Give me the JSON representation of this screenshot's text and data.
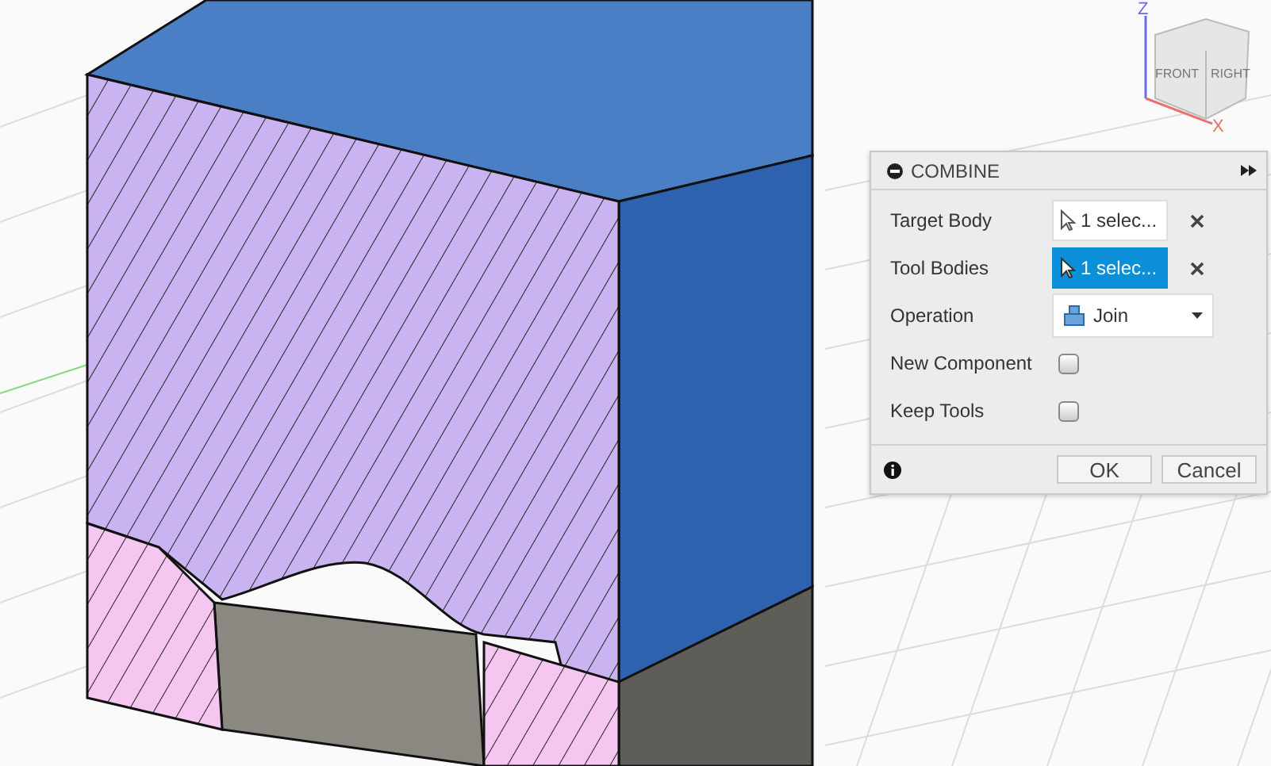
{
  "viewcube": {
    "faces": [
      "FRONT",
      "RIGHT"
    ],
    "axes": [
      "Z",
      "X"
    ]
  },
  "dialog": {
    "title": "COMBINE",
    "rows": [
      {
        "kind": "selection",
        "label": "Target Body",
        "value": "1 selec...",
        "selected": false
      },
      {
        "kind": "selection",
        "label": "Tool Bodies",
        "value": "1 selec...",
        "selected": true
      },
      {
        "kind": "dropdown",
        "label": "Operation",
        "value": "Join"
      },
      {
        "kind": "checkbox",
        "label": "New Component",
        "checked": false
      },
      {
        "kind": "checkbox",
        "label": "Keep Tools",
        "checked": false
      }
    ],
    "buttons": [
      "OK",
      "Cancel"
    ]
  }
}
